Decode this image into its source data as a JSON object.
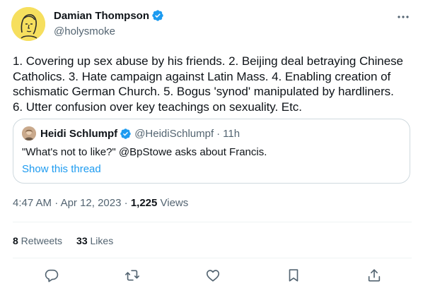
{
  "author": {
    "display_name": "Damian Thompson",
    "handle": "@holysmoke"
  },
  "tweet": {
    "text": "1. Covering up sex abuse by his friends. 2. Beijing deal betraying Chinese\nCatholics. 3. Hate campaign against Latin Mass. 4. Enabling creation of\nschismatic German Church. 5. Bogus 'synod' manipulated by hardliners.\n6. Utter confusion over key teachings on sexuality. Etc."
  },
  "quote": {
    "display_name": "Heidi Schlumpf",
    "handle": "@HeidiSchlumpf",
    "separator": "·",
    "time": "11h",
    "text": "\"What's not to like?\" @BpStowe asks about Francis.",
    "show_thread": "Show this thread"
  },
  "meta": {
    "time": "4:47 AM",
    "sep1": " · ",
    "date": "Apr 12, 2023",
    "sep2": " · ",
    "views_count": "1,225",
    "views_label": " Views"
  },
  "stats": {
    "retweets_count": "8",
    "retweets_label": " Retweets",
    "likes_count": "33",
    "likes_label": " Likes"
  },
  "icons": {
    "verified": "verified-badge-icon",
    "more": "more-options-icon",
    "reply": "reply-icon",
    "retweet": "retweet-icon",
    "like": "like-icon",
    "bookmark": "bookmark-icon",
    "share": "share-icon"
  },
  "colors": {
    "accent": "#1d9bf0",
    "text": "#0f1419",
    "secondary": "#536471",
    "avatar_bg": "#f6df5e"
  }
}
